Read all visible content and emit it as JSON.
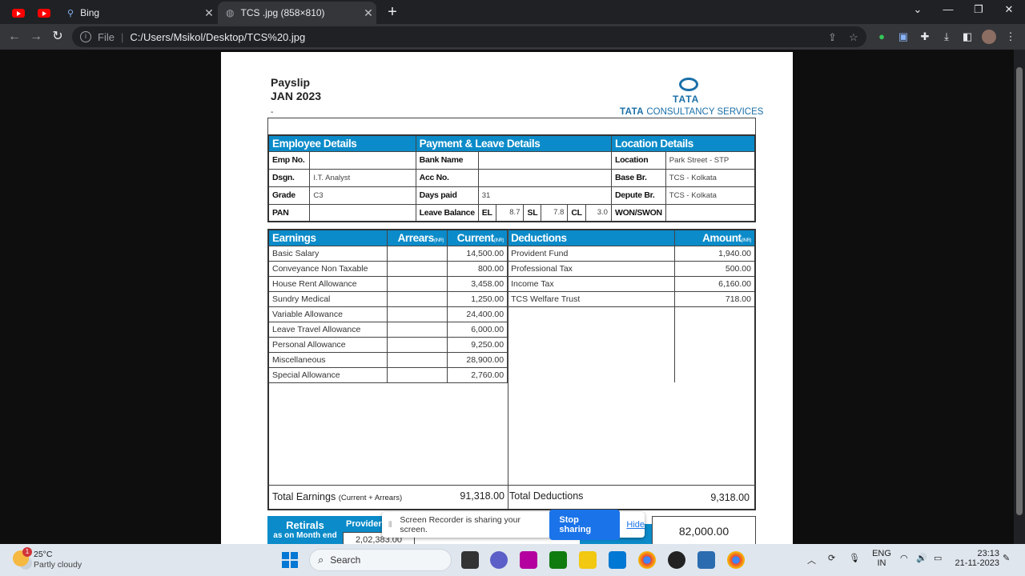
{
  "browser": {
    "tabs": [
      {
        "title": "Bing"
      },
      {
        "title": "TCS .jpg (858×810)"
      }
    ],
    "address": {
      "scheme_label": "File",
      "url": "C:/Users/Msikol/Desktop/TCS%20.jpg"
    }
  },
  "payslip": {
    "title": "Payslip",
    "period": "JAN 2023",
    "dash": "-",
    "logo_top": "TATA",
    "logo_bold": "TATA",
    "logo_rest": "CONSULTANCY SERVICES",
    "sections": {
      "employee": "Employee Details",
      "payment": "Payment & Leave Details",
      "location": "Location Details"
    },
    "employee": {
      "emp_no_label": "Emp No.",
      "emp_no": "",
      "dsgn_label": "Dsgn.",
      "dsgn": "I.T. Analyst",
      "grade_label": "Grade",
      "grade": "C3",
      "pan_label": "PAN",
      "pan": ""
    },
    "payment": {
      "bank_label": "Bank Name",
      "bank": "",
      "acc_label": "Acc No.",
      "acc": "",
      "days_label": "Days paid",
      "days": "31",
      "leave_label": "Leave Balance",
      "el_label": "EL",
      "el": "8.7",
      "sl_label": "SL",
      "sl": "7.8",
      "cl_label": "CL",
      "cl": "3.0"
    },
    "location": {
      "loc_label": "Location",
      "loc": "Park Street - STP",
      "base_label": "Base Br.",
      "base": "TCS - Kolkata",
      "depute_label": "Depute Br.",
      "depute": "TCS - Kolkata",
      "won_label": "WON/SWON",
      "won": ""
    },
    "earnings_headers": {
      "earnings": "Earnings",
      "arrears": "Arrears",
      "current": "Current",
      "inr": "(INR)",
      "deductions": "Deductions",
      "amount": "Amount"
    },
    "earnings": [
      {
        "name": "Basic Salary",
        "arrears": "",
        "current": "14,500.00"
      },
      {
        "name": "Conveyance Non Taxable",
        "arrears": "",
        "current": "800.00"
      },
      {
        "name": "House Rent Allowance",
        "arrears": "",
        "current": "3,458.00"
      },
      {
        "name": "Sundry Medical",
        "arrears": "",
        "current": "1,250.00"
      },
      {
        "name": "Variable Allowance",
        "arrears": "",
        "current": "24,400.00"
      },
      {
        "name": "Leave Travel Allowance",
        "arrears": "",
        "current": "6,000.00"
      },
      {
        "name": "Personal Allowance",
        "arrears": "",
        "current": "9,250.00"
      },
      {
        "name": "Miscellaneous",
        "arrears": "",
        "current": "28,900.00"
      },
      {
        "name": "Special Allowance",
        "arrears": "",
        "current": "2,760.00"
      }
    ],
    "deductions": [
      {
        "name": "Provident Fund",
        "amount": "1,940.00"
      },
      {
        "name": "Professional Tax",
        "amount": "500.00"
      },
      {
        "name": "Income Tax",
        "amount": "6,160.00"
      },
      {
        "name": "TCS Welfare Trust",
        "amount": "718.00"
      }
    ],
    "totals": {
      "earnings_label": "Total Earnings",
      "earnings_note": "(Current + Arrears)",
      "earnings_value": "91,318.00",
      "deductions_label": "Total Deductions",
      "deductions_value": "9,318.00"
    },
    "retirals": {
      "label": "Retirals",
      "sub": "as on Month end",
      "provider_label": "Provider",
      "provider_value": "2,02,383.00"
    },
    "net_pay": "82,000.00"
  },
  "share_bar": {
    "message": "Screen Recorder is sharing your screen.",
    "stop_label": "Stop sharing",
    "hide_label": "Hide"
  },
  "taskbar": {
    "weather_temp": "25°C",
    "weather_cond": "Partly cloudy",
    "weather_badge": "1",
    "search_label": "Search",
    "lang": "ENG",
    "region": "IN",
    "time": "23:13",
    "date": "21-11-2023"
  }
}
